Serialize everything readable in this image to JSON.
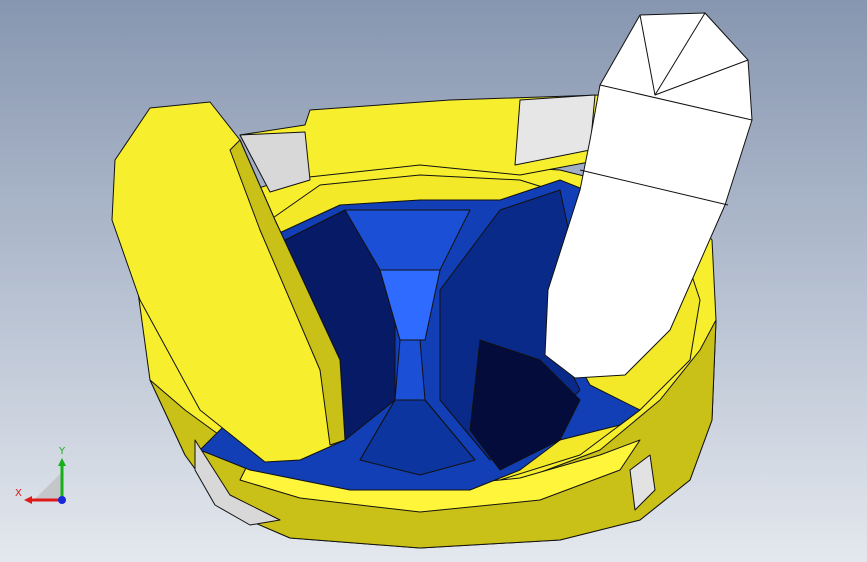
{
  "viewport": {
    "colors": {
      "yellow": "#f7ef2e",
      "yellow_shade": "#c9c018",
      "yellow_dark": "#8f8810",
      "blue": "#123fb5",
      "blue_light": "#2f6bff",
      "blue_dark": "#071a66",
      "white": "#ffffff",
      "grey": "#d8d8d8"
    }
  },
  "triad": {
    "x_label": "X",
    "y_label": "Y",
    "x_color": "#e01818",
    "y_color": "#18b018",
    "z_color": "#1828d8"
  }
}
